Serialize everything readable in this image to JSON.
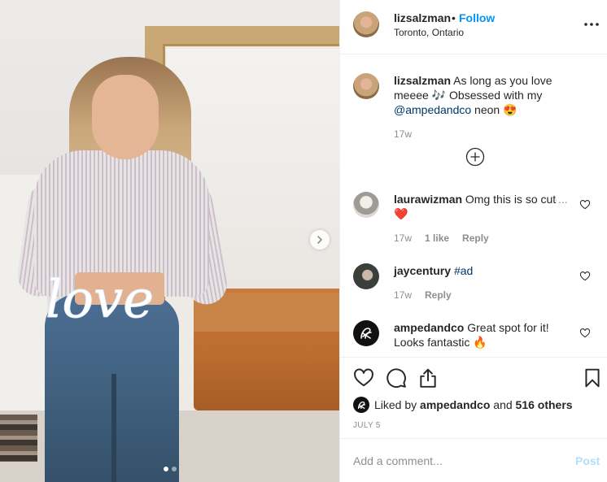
{
  "header": {
    "username": "lizsalzman",
    "separator": "•",
    "follow_label": "Follow",
    "location": "Toronto, Ontario",
    "more_glyph": "•••"
  },
  "caption": {
    "username": "lizsalzman",
    "text_before": " As long as you love meeee 🎶 Obsessed with my ",
    "mention": "@ampedandco",
    "text_after": " neon 😍",
    "age": "17w"
  },
  "comments": [
    {
      "username": "laurawizman",
      "text": " Omg this is so cute",
      "overflow": "...",
      "line2": "❤️",
      "age": "17w",
      "likes": "1 like",
      "reply": "Reply"
    },
    {
      "username": "jaycentury",
      "hashtag": "#ad",
      "age": "17w",
      "reply": "Reply"
    },
    {
      "username": "ampedandco",
      "text": " Great spot for it!",
      "line2": "Looks fantastic 🔥"
    }
  ],
  "likes": {
    "prefix": "Liked by",
    "user": "ampedandco",
    "middle": "and",
    "others": "516 others"
  },
  "date": "JULY 5",
  "composer": {
    "placeholder": "Add a comment...",
    "post_label": "Post"
  },
  "carousel": {
    "count": 2,
    "current": 1
  },
  "photo": {
    "neon_text": "love"
  },
  "icons": [
    "more-icon",
    "plus-circle-icon",
    "heart-icon",
    "comment-icon",
    "share-icon",
    "bookmark-icon",
    "chevron-right-icon",
    "ampedandco-logo"
  ],
  "colors": {
    "link_blue": "#0095f6",
    "mention": "#00376b",
    "muted": "#8e8e8e",
    "post_disabled": "#b2dffc"
  }
}
